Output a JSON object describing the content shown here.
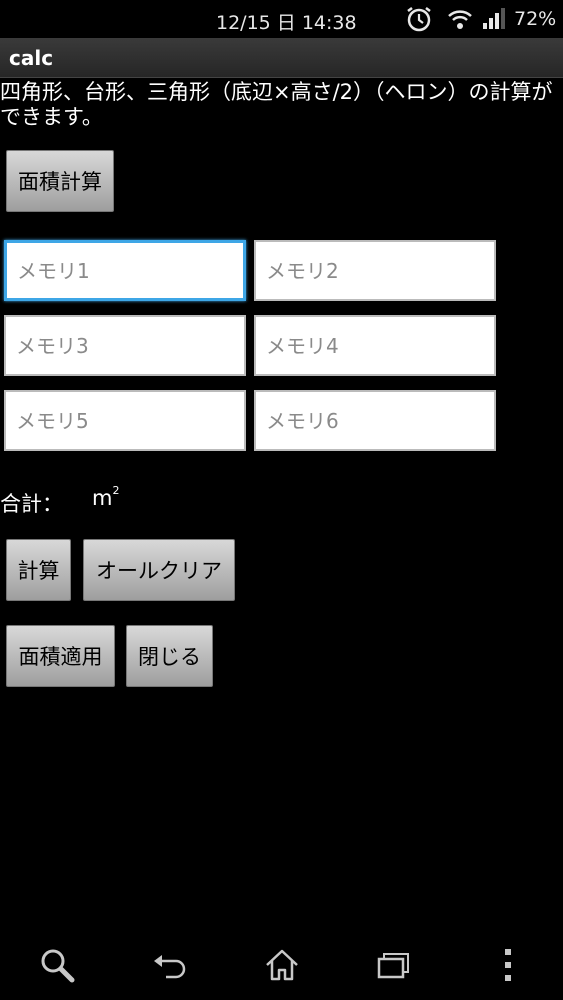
{
  "status_bar": {
    "time": "12/15 日 14:38",
    "battery": "72%",
    "icons": [
      "alarm-icon",
      "wifi-icon",
      "signal-icon"
    ]
  },
  "app": {
    "title": "calc"
  },
  "description": "四角形、台形、三角形（底辺×高さ/2）（ヘロン）の計算ができます。",
  "buttons": {
    "area_calc": "面積計算",
    "calc": "計算",
    "all_clear": "オールクリア",
    "apply_area": "面積適用",
    "close": "閉じる"
  },
  "memory_fields": [
    {
      "placeholder": "メモリ1",
      "value": ""
    },
    {
      "placeholder": "メモリ2",
      "value": ""
    },
    {
      "placeholder": "メモリ3",
      "value": ""
    },
    {
      "placeholder": "メモリ4",
      "value": ""
    },
    {
      "placeholder": "メモリ5",
      "value": ""
    },
    {
      "placeholder": "メモリ6",
      "value": ""
    }
  ],
  "total": {
    "label": "合計：",
    "value": "",
    "unit": "m",
    "unit_sup": "2"
  },
  "nav_bar": {
    "icons": [
      "search-icon",
      "back-icon",
      "home-icon",
      "recent-apps-icon",
      "menu-icon"
    ]
  },
  "colors": {
    "background": "#000000",
    "focus": "#3ea6e6",
    "button": "#c0c0c0"
  }
}
